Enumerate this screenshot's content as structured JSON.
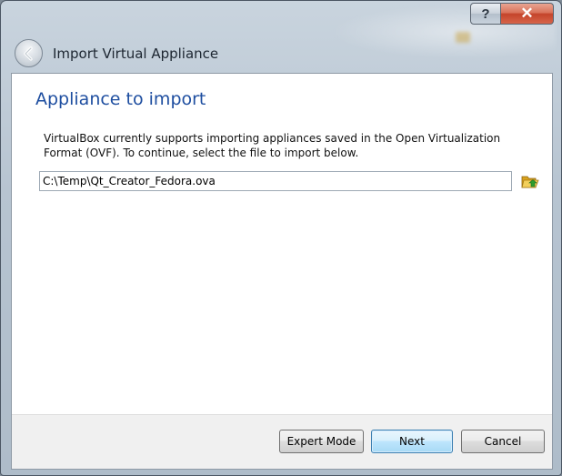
{
  "window": {
    "title": "Import Virtual Appliance",
    "help_label": "?",
    "close_label": "✕"
  },
  "page": {
    "heading": "Appliance to import",
    "description": "VirtualBox currently supports importing appliances saved in the Open Virtualization Format (OVF). To continue, select the file to import below."
  },
  "file_input": {
    "value": "C:\\Temp\\Qt_Creator_Fedora.ova",
    "placeholder": ""
  },
  "buttons": {
    "expert_mode": "Expert Mode",
    "next": "Next",
    "cancel": "Cancel"
  },
  "icons": {
    "back": "back-arrow-icon",
    "open_folder": "open-folder-icon",
    "help": "help-icon",
    "close": "close-icon"
  },
  "colors": {
    "heading": "#1e4ea0",
    "close_button": "#c4442a",
    "default_button_border": "#3c7fb1",
    "folder_icon": "#e8b62c",
    "folder_arrow": "#2e9e2e"
  }
}
